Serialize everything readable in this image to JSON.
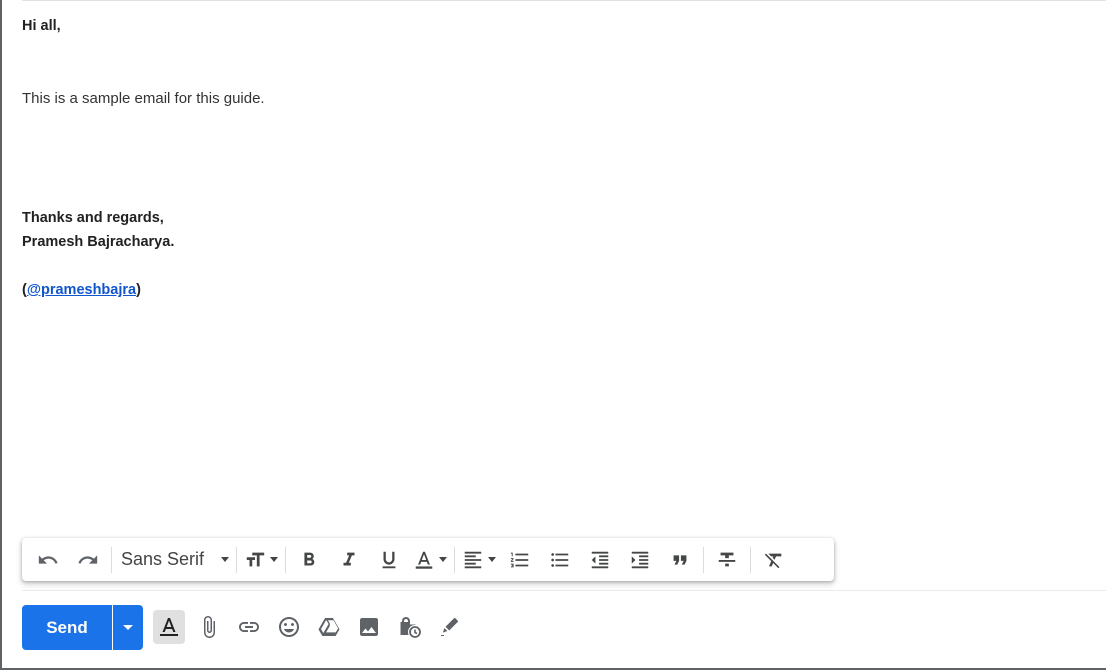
{
  "email": {
    "greeting": "Hi all,",
    "body_text": "This is a sample email for this guide.",
    "closing": "Thanks and regards,",
    "sender_name": "Pramesh Bajracharya.",
    "handle_open": "(",
    "handle_link": "@prameshbajra",
    "handle_close": ")"
  },
  "toolbar": {
    "font_name": "Sans Serif",
    "icons": [
      "undo-icon",
      "redo-icon",
      "font-size-icon",
      "bold-icon",
      "italic-icon",
      "underline-icon",
      "text-color-icon",
      "align-icon",
      "numbered-list-icon",
      "bulleted-list-icon",
      "indent-less-icon",
      "indent-more-icon",
      "quote-icon",
      "strikethrough-icon",
      "remove-formatting-icon"
    ]
  },
  "compose_actions": {
    "send_label": "Send",
    "icons": [
      "formatting-options-icon",
      "attach-file-icon",
      "insert-link-icon",
      "emoji-icon",
      "google-drive-icon",
      "insert-photo-icon",
      "confidential-mode-icon",
      "signature-icon"
    ]
  },
  "colors": {
    "send_button": "#1a73e8",
    "link": "#1155cc",
    "icon_gray": "#444746"
  }
}
